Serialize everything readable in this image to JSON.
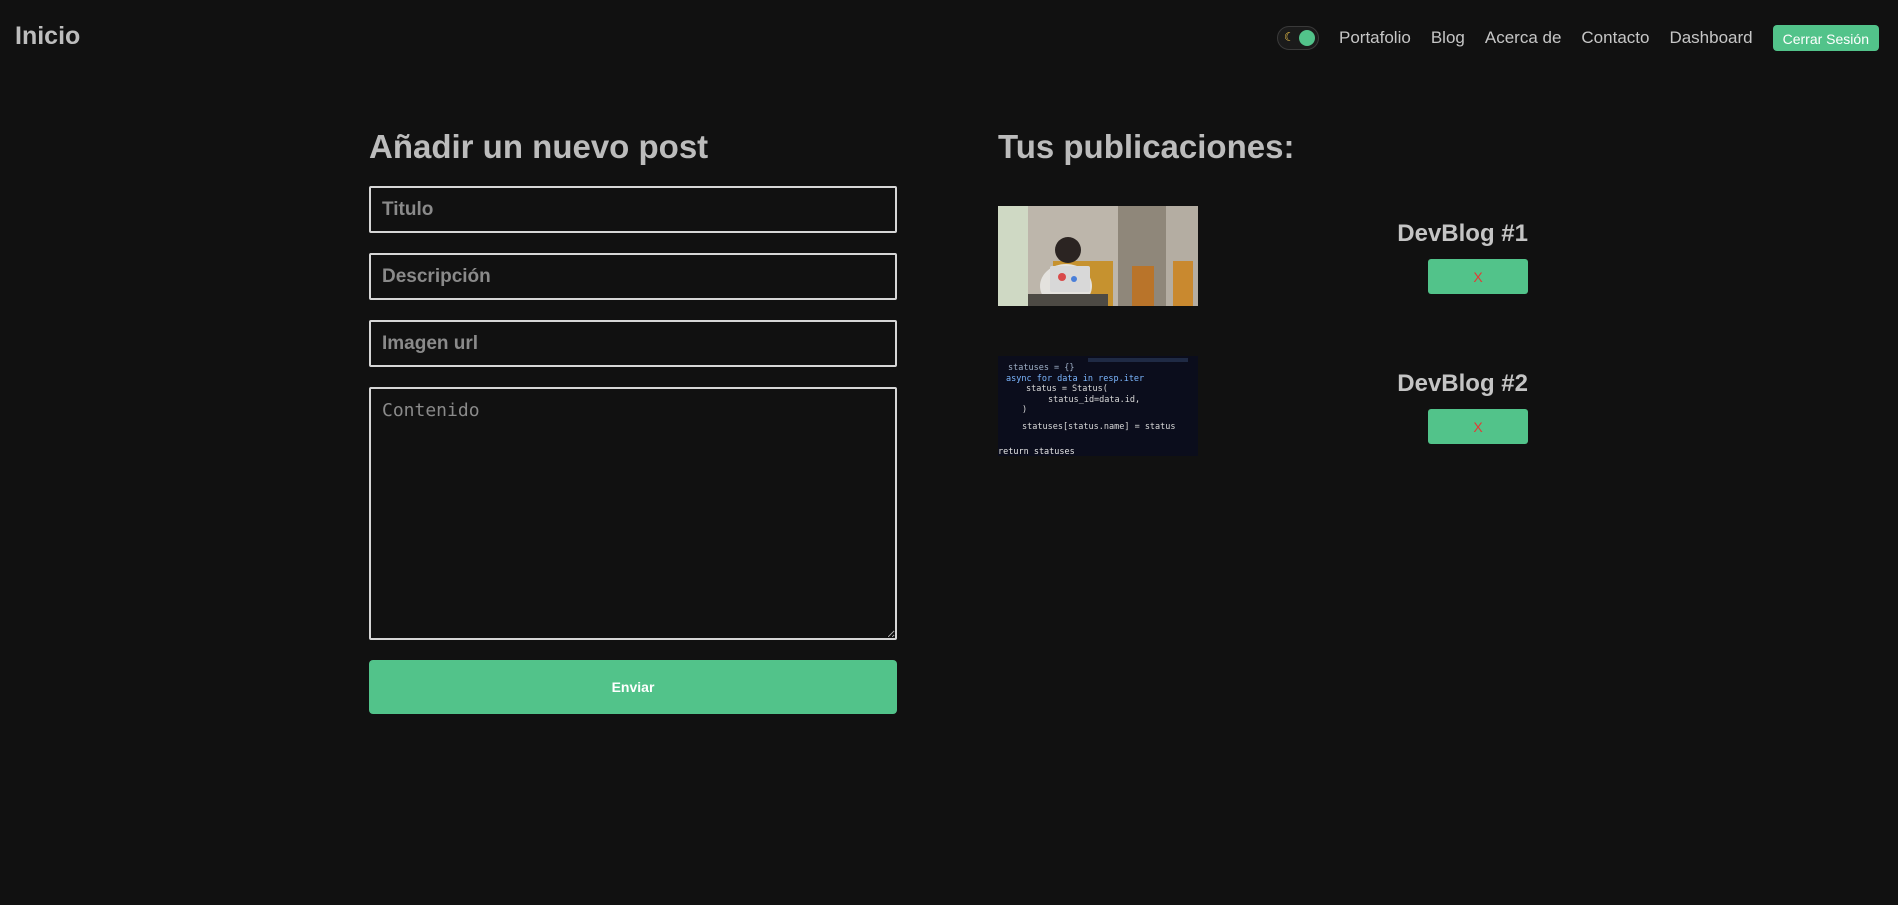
{
  "header": {
    "brand": "Inicio",
    "theme_toggle_icon": "moon-icon",
    "nav_links": [
      "Portafolio",
      "Blog",
      "Acerca de",
      "Contacto",
      "Dashboard"
    ],
    "logout_label": "Cerrar Sesión"
  },
  "form": {
    "title": "Añadir un nuevo post",
    "fields": {
      "titulo_placeholder": "Titulo",
      "descripcion_placeholder": "Descripción",
      "imagen_placeholder": "Imagen url",
      "contenido_placeholder": "Contenido"
    },
    "submit_label": "Enviar"
  },
  "posts": {
    "title": "Tus publicaciones:",
    "items": [
      {
        "title": "DevBlog #1",
        "delete_label": "X",
        "image": "photo-person-laptop"
      },
      {
        "title": "DevBlog #2",
        "delete_label": "X",
        "image": "code-screen"
      }
    ]
  },
  "colors": {
    "background": "#111111",
    "accent": "#52c38a",
    "danger_text": "#e53935",
    "text": "#c4c4c4"
  }
}
